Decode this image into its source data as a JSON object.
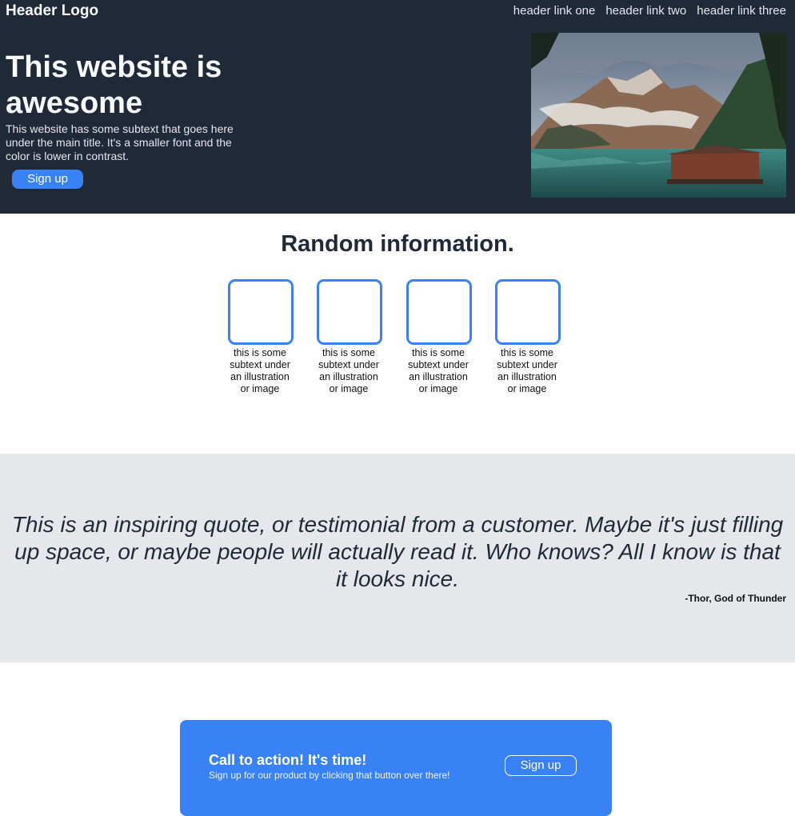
{
  "header": {
    "logo": "Header Logo",
    "links": [
      "header link one",
      "header link two",
      "header link three"
    ]
  },
  "hero": {
    "title": "This website is awesome",
    "subtext": "This website has some subtext that goes here under the main title. It's a smaller font and the color is lower in contrast.",
    "button_label": "Sign up",
    "image_icon": "mountain-lake-photo"
  },
  "info": {
    "title": "Random information.",
    "cards": [
      {
        "caption": "this is some subtext under an illustration or image"
      },
      {
        "caption": "this is some subtext under an illustration or image"
      },
      {
        "caption": "this is some subtext under an illustration or image"
      },
      {
        "caption": "this is some subtext under an illustration or image"
      }
    ]
  },
  "quote": {
    "text": "This is an inspiring quote, or testimonial from a customer. Maybe it's just filling up space, or maybe people will actually read it. Who knows? All I know is that it looks nice.",
    "attribution": "-Thor, God of Thunder"
  },
  "cta": {
    "title": "Call to action! It's time!",
    "subtext": "Sign up for our product by clicking that button over there!",
    "button_label": "Sign up"
  },
  "colors": {
    "dark": "#1f2937",
    "accent": "#3882f6",
    "light": "#e5e7eb"
  }
}
